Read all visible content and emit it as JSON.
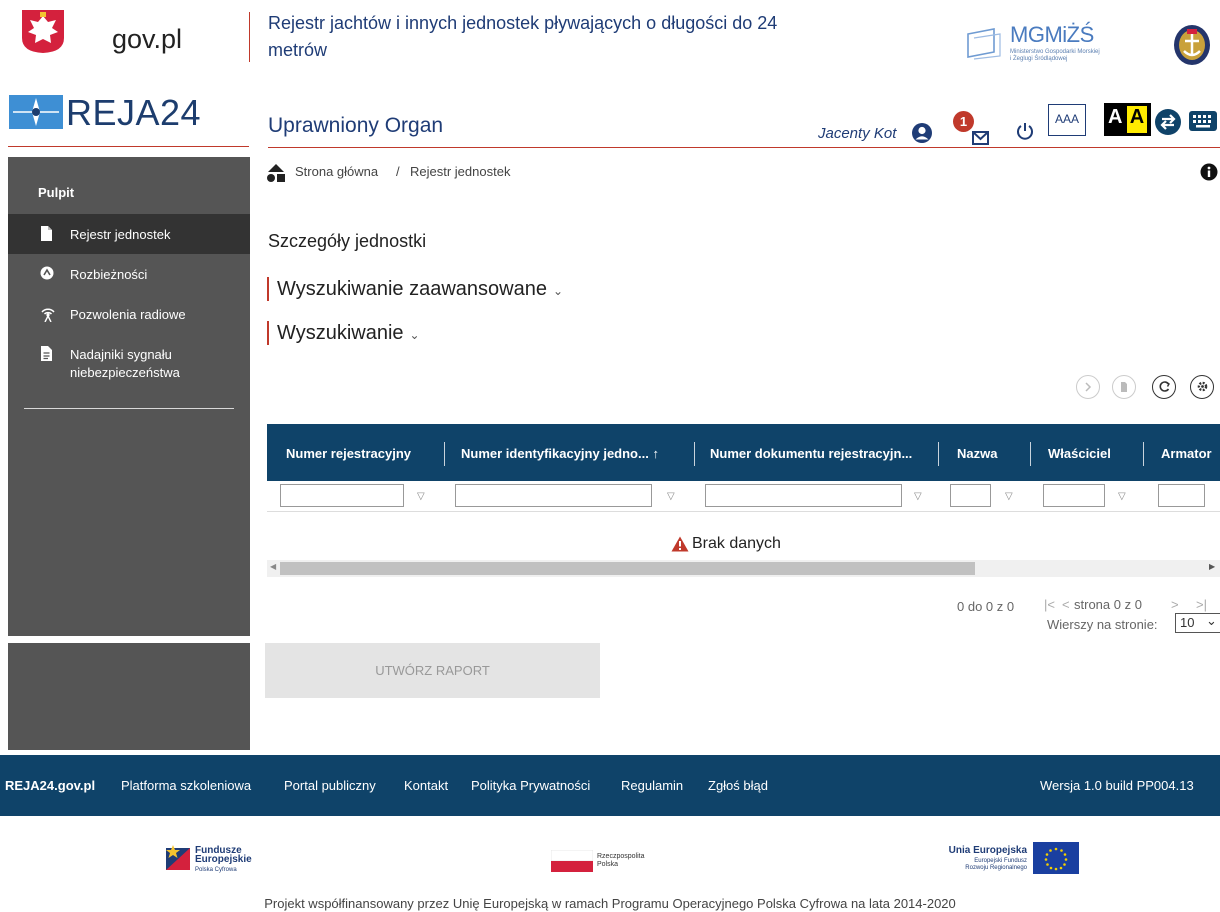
{
  "header": {
    "gov_logo_text": "gov.pl",
    "registry_title": "Rejestr jachtów i innych jednostek pływających o długości do 24 metrów",
    "ministry": {
      "name": "MGMiŻŚ",
      "line1": "Ministerstwo Gospodarki Morskiej",
      "line2": "i Żeglugi Śródlądowej"
    },
    "app_name": "REJA24",
    "section_title": "Uprawniony Organ",
    "user_name": "Jacenty Kot",
    "message_count": "1",
    "font_size_label": "AAA",
    "contrast_label_1": "A",
    "contrast_label_2": "A",
    "icons": [
      "poland-emblem-icon",
      "ministry-logo-icon",
      "maritime-seal-icon",
      "user-icon",
      "mail-icon",
      "power-icon",
      "swap-icon",
      "keyboard-icon"
    ]
  },
  "sidebar": {
    "heading": "Pulpit",
    "items": [
      {
        "label": "Rejestr jednostek",
        "icon": "document-icon",
        "active": true
      },
      {
        "label": "Rozbieżności",
        "icon": "discrepancy-icon",
        "active": false
      },
      {
        "label": "Pozwolenia radiowe",
        "icon": "antenna-icon",
        "active": false
      },
      {
        "label": "Nadajniki sygnału niebezpieczeństwa",
        "icon": "file-text-icon",
        "active": false
      }
    ]
  },
  "breadcrumb": {
    "home": "Strona główna",
    "separator": "/",
    "current": "Rejestr jednostek"
  },
  "main": {
    "details_title": "Szczegóły jednostki",
    "advanced_search": "Wyszukiwanie zaawansowane",
    "search": "Wyszukiwanie",
    "chevron": "⌄",
    "toolbar_icons": [
      "next-icon",
      "export-icon",
      "refresh-icon",
      "settings-icon"
    ]
  },
  "table": {
    "columns": [
      "Numer rejestracyjny",
      "Numer identyfikacyjny jedno... ↑",
      "Numer dokumentu rejestracyjn...",
      "Nazwa",
      "Właściciel",
      "Armator"
    ],
    "filter_symbol": "▽",
    "empty_message": "Brak danych"
  },
  "pagination": {
    "range": "0 do 0 z 0",
    "first": "|<",
    "prev": "<",
    "page_text": "strona 0 z 0",
    "next": ">",
    "last": ">|",
    "rows_label": "Wierszy na stronie:",
    "rows_value": "10",
    "rows_options": [
      "10"
    ]
  },
  "report_button": "UTWÓRZ RAPORT",
  "footer": {
    "brand": "REJA24.gov.pl",
    "links": [
      "Platforma szkoleniowa",
      "Portal publiczny",
      "Kontakt",
      "Polityka Prywatności",
      "Regulamin",
      "Zgłoś błąd"
    ],
    "version": "Wersja 1.0 build PP004.13",
    "fe_line1": "Fundusze",
    "fe_line2": "Europejskie",
    "fe_line3": "Polska Cyfrowa",
    "rp_line1": "Rzeczpospolita",
    "rp_line2": "Polska",
    "eu_line1": "Unia Europejska",
    "eu_line2": "Europejski Fundusz",
    "eu_line3": "Rozwoju Regionalnego",
    "cofinance": "Projekt współfinansowany przez Unię Europejską w ramach Programu Operacyjnego Polska Cyfrowa na lata 2014-2020"
  },
  "colors": {
    "navy": "#0f4369",
    "title_blue": "#1f3c76",
    "accent_red": "#c0392b",
    "sidebar_bg": "#555555",
    "sidebar_active": "#333333"
  }
}
